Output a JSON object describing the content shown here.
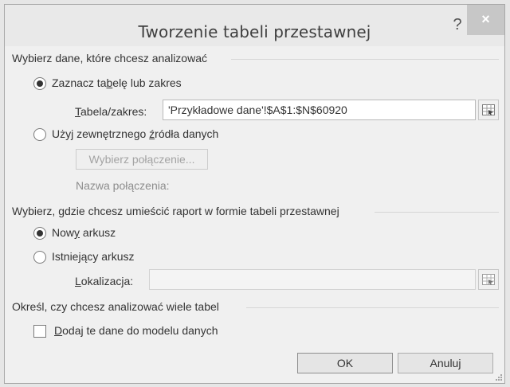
{
  "window": {
    "title": "Tworzenie tabeli przestawnej",
    "help_label": "?",
    "close_label": "×"
  },
  "data_source": {
    "header": "Wybierz dane, które chcesz analizować",
    "option_range": {
      "label_pre": "Zaznacz ta",
      "label_accel": "b",
      "label_post": "elę lub zakres",
      "selected": true
    },
    "range_field": {
      "label_accel": "T",
      "label_post": "abela/zakres:",
      "value": "'Przykładowe dane'!$A$1:$N$60920"
    },
    "option_external": {
      "label_pre": "Użyj zewnętrznego ",
      "label_accel": "ź",
      "label_post": "ródła danych",
      "selected": false
    },
    "choose_connection_button": "Wybierz połączenie...",
    "connection_name_label": "Nazwa połączenia:"
  },
  "destination": {
    "header": "Wybierz, gdzie chcesz umieścić raport w formie tabeli przestawnej",
    "option_new_sheet": {
      "label_pre": "Now",
      "label_accel": "y",
      "label_post": " arkusz",
      "selected": true
    },
    "option_existing_sheet": {
      "label_pre": "Istnie",
      "label_accel": "j",
      "label_post": "ący arkusz",
      "selected": false
    },
    "location_field": {
      "label_accel": "L",
      "label_post": "okalizacja:",
      "value": ""
    }
  },
  "multiple_tables": {
    "header": "Określ, czy chcesz analizować wiele tabel",
    "checkbox": {
      "label_accel": "D",
      "label_post": "odaj te dane do modelu danych",
      "checked": false
    }
  },
  "buttons": {
    "ok": "OK",
    "cancel": "Anuluj"
  },
  "colors": {
    "dialog_bg": "#f0f0f0",
    "close_button_bg": "#c7c7c7",
    "text": "#333333",
    "disabled_text": "#8d8d8d"
  }
}
